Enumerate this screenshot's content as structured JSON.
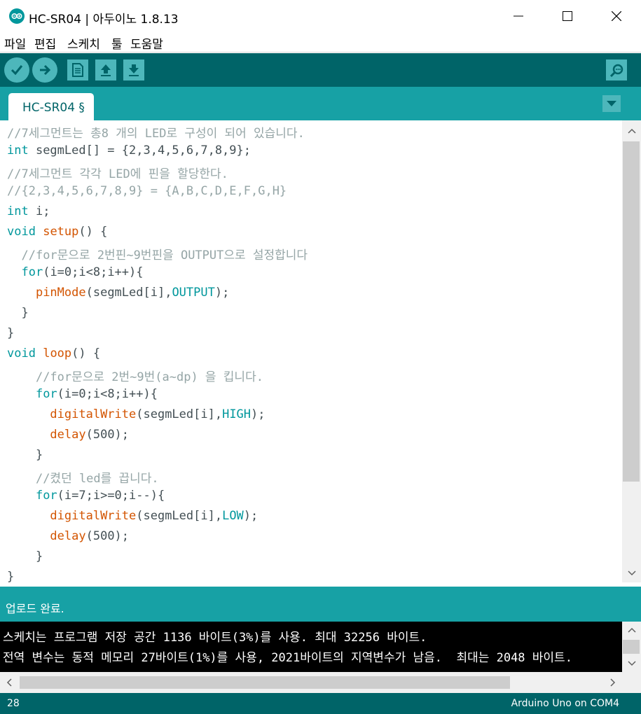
{
  "window": {
    "title": "HC-SR04 | 아두이노 1.8.13"
  },
  "menu": [
    "파일",
    "편집",
    "스케치",
    "툴",
    "도움말"
  ],
  "toolbar": {
    "buttons": [
      "verify-icon",
      "upload-icon",
      "new-icon",
      "open-icon",
      "save-icon"
    ],
    "serial_monitor": "serial-monitor-icon"
  },
  "tab": {
    "label": "HC-SR04 §"
  },
  "editor": {
    "lines": [
      [
        [
          "cmt",
          "//7세그먼트는 총8 개의 LED로 구성이 되어 있습니다."
        ]
      ],
      [
        [
          "kw",
          "int"
        ],
        [
          "",
          " segmLed[] = {2,3,4,5,6,7,8,9};"
        ]
      ],
      [
        [
          "cmt",
          "//7세그먼트 각각 LED에 핀을 할당한다."
        ]
      ],
      [
        [
          "cmt",
          "//{2,3,4,5,6,7,8,9} = {A,B,C,D,E,F,G,H}"
        ]
      ],
      [
        [
          "kw",
          "int"
        ],
        [
          "",
          " i;"
        ]
      ],
      [
        [
          "kw",
          "void"
        ],
        [
          "",
          " "
        ],
        [
          "fn",
          "setup"
        ],
        [
          "",
          "() {"
        ]
      ],
      [
        [
          "",
          "  "
        ],
        [
          "cmt",
          "//for문으로 2번핀~9번핀을 OUTPUT으로 설정합니다"
        ]
      ],
      [
        [
          "",
          "  "
        ],
        [
          "kw",
          "for"
        ],
        [
          "",
          "(i=0;i<8;i++){"
        ]
      ],
      [
        [
          "",
          "    "
        ],
        [
          "fn",
          "pinMode"
        ],
        [
          "",
          "(segmLed[i],"
        ],
        [
          "kw",
          "OUTPUT"
        ],
        [
          "",
          ");"
        ]
      ],
      [
        [
          "",
          "  }"
        ]
      ],
      [
        [
          "",
          "}"
        ]
      ],
      [
        [
          "kw",
          "void"
        ],
        [
          "",
          " "
        ],
        [
          "fn",
          "loop"
        ],
        [
          "",
          "() {"
        ]
      ],
      [
        [
          "",
          "    "
        ],
        [
          "cmt",
          "//for문으로 2번~9번(a~dp) 을 킵니다."
        ]
      ],
      [
        [
          "",
          "    "
        ],
        [
          "kw",
          "for"
        ],
        [
          "",
          "(i=0;i<8;i++){"
        ]
      ],
      [
        [
          "",
          "      "
        ],
        [
          "fn",
          "digitalWrite"
        ],
        [
          "",
          "(segmLed[i],"
        ],
        [
          "kw",
          "HIGH"
        ],
        [
          "",
          ");"
        ]
      ],
      [
        [
          "",
          "      "
        ],
        [
          "fn",
          "delay"
        ],
        [
          "",
          "(500);"
        ]
      ],
      [
        [
          "",
          "    }"
        ]
      ],
      [
        [
          "",
          "    "
        ],
        [
          "cmt",
          "//켰던 led를 끕니다."
        ]
      ],
      [
        [
          "",
          "    "
        ],
        [
          "kw",
          "for"
        ],
        [
          "",
          "(i=7;i>=0;i--){"
        ]
      ],
      [
        [
          "",
          "      "
        ],
        [
          "fn",
          "digitalWrite"
        ],
        [
          "",
          "(segmLed[i],"
        ],
        [
          "kw",
          "LOW"
        ],
        [
          "",
          ");"
        ]
      ],
      [
        [
          "",
          "      "
        ],
        [
          "fn",
          "delay"
        ],
        [
          "",
          "(500);"
        ]
      ],
      [
        [
          "",
          "    }"
        ]
      ],
      [
        [
          "",
          "}"
        ]
      ]
    ]
  },
  "status": {
    "message": "업로드 완료."
  },
  "console": {
    "lines": [
      "스케치는 프로그램 저장 공간 1136 바이트(3%)를 사용. 최대 32256 바이트.",
      "전역 변수는 동적 메모리 27바이트(1%)를 사용, 2021바이트의 지역변수가 남음.  최대는 2048 바이트."
    ]
  },
  "footer": {
    "line": "28",
    "board": "Arduino Uno on COM4"
  },
  "colors": {
    "teal_dark": "#006468",
    "teal": "#17a1a5",
    "keyword": "#00979c",
    "function": "#d35400",
    "comment": "#95a5a6"
  }
}
